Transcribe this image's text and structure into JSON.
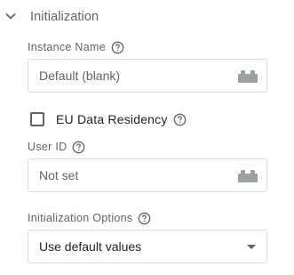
{
  "section": {
    "title": "Initialization"
  },
  "instance_name": {
    "label": "Instance Name",
    "placeholder": "Default (blank)"
  },
  "eu_data_residency": {
    "label": "EU Data Residency",
    "checked": false
  },
  "user_id": {
    "label": "User ID",
    "value": "Not set"
  },
  "init_options": {
    "label": "Initialization Options",
    "selected": "Use default values"
  },
  "icons": {
    "section_toggle": "chevron-down-icon",
    "help": "help-circle-icon",
    "variable": "variable-block-icon"
  }
}
